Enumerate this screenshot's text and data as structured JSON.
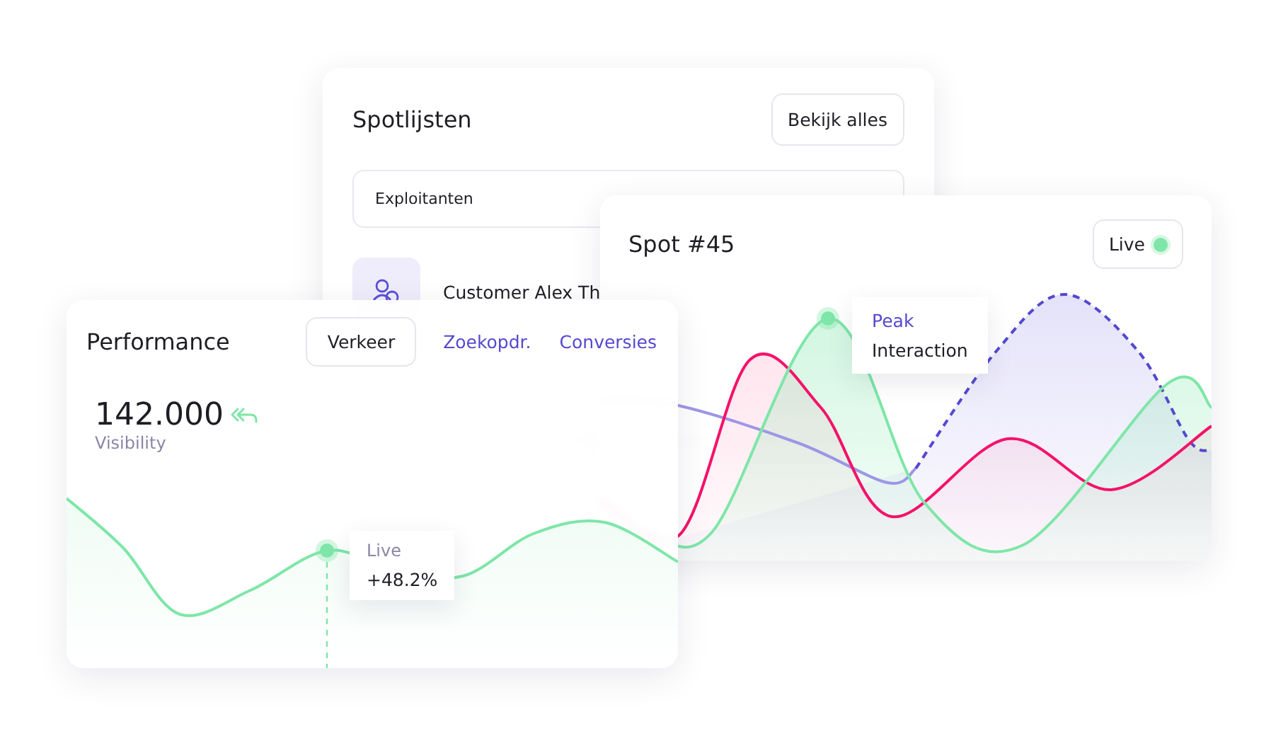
{
  "spotlist": {
    "title": "Spotlijsten",
    "button": "Bekijk alles",
    "header": {
      "column_1": "Exploitanten"
    },
    "rows": [
      {
        "name": "Customer Alex Th"
      }
    ]
  },
  "spot": {
    "title": "Spot #45",
    "badge": {
      "label": "Live",
      "on": true
    },
    "tooltip": {
      "label": "Peak",
      "value": "Interaction"
    }
  },
  "performance": {
    "title": "Performance",
    "tabs": [
      {
        "label": "Verkeer",
        "selected": true
      },
      {
        "label": "Zoekopdr.",
        "selected": false
      },
      {
        "label": "Conversies",
        "selected": false
      }
    ],
    "value": "142.000",
    "caption": "Visibility",
    "tooltip": {
      "label": "Live",
      "value": "+48.2%"
    }
  }
}
